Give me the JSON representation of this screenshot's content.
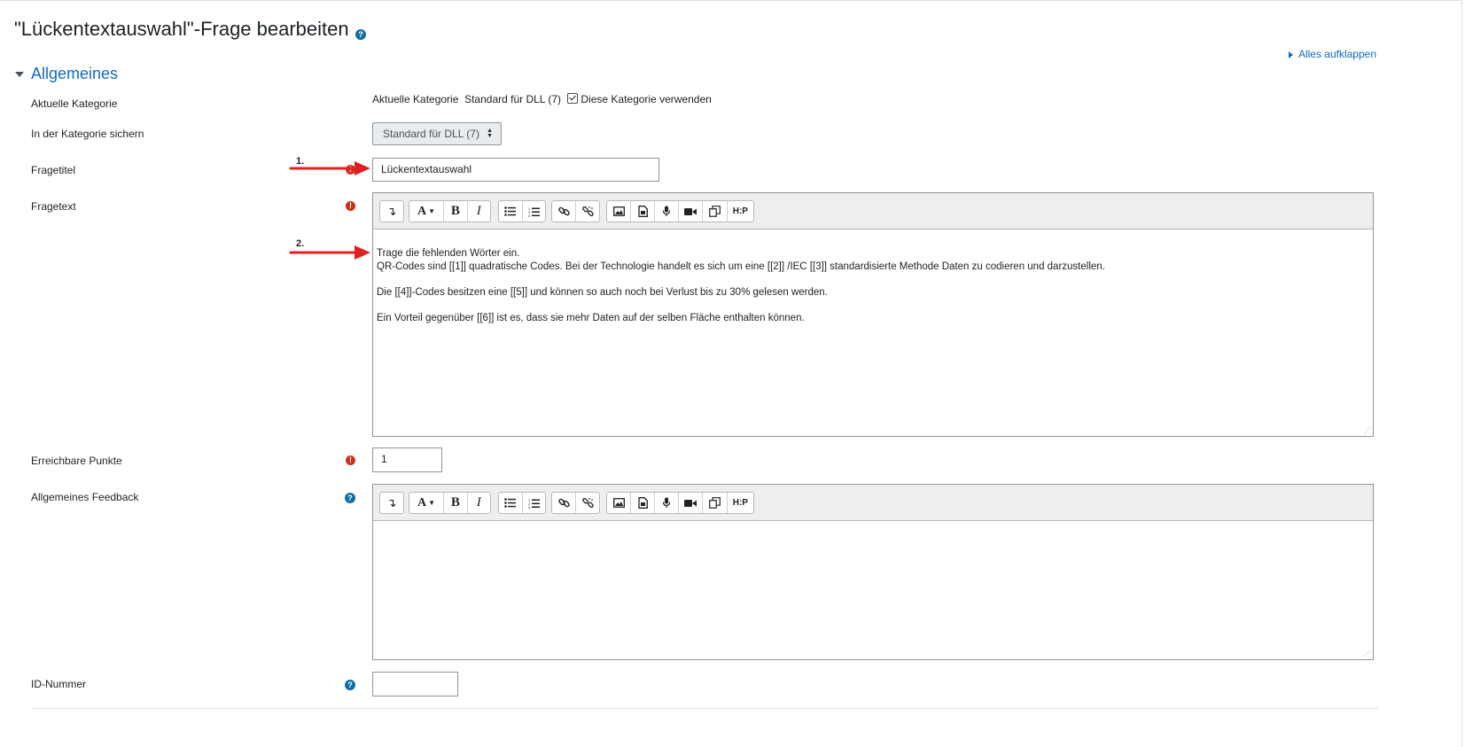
{
  "page": {
    "title": "\"Lückentextauswahl\"-Frage bearbeiten",
    "expand_all": "Alles aufklappen",
    "section": "Allgemeines"
  },
  "fields": {
    "current_category_label": "Aktuelle Kategorie",
    "current_category_prefix": "Aktuelle Kategorie",
    "current_category_value": "Standard für DLL (7)",
    "use_category_label": "Diese Kategorie verwenden",
    "save_in_category_label": "In der Kategorie sichern",
    "save_in_category_value": "Standard für DLL (7)",
    "question_title_label": "Fragetitel",
    "question_title_value": "Lückentextauswahl",
    "question_text_label": "Fragetext",
    "points_label": "Erreichbare Punkte",
    "points_value": "1",
    "general_feedback_label": "Allgemeines Feedback",
    "id_number_label": "ID-Nummer",
    "id_number_value": ""
  },
  "question_text": {
    "line1": "Trage die fehlenden Wörter ein.",
    "line2": "QR-Codes sind [[1]] quadratische Codes. Bei der Technologie handelt es sich um eine [[2]] /IEC [[3]] standardisierte Methode Daten zu codieren und darzustellen.",
    "para2": "Die [[4]]-Codes besitzen eine [[5]] und können so auch noch bei Verlust bis zu 30% gelesen werden.",
    "para3": "Ein Vorteil gegenüber [[6]] ist es, dass sie mehr Daten auf der selben Fläche enthalten können."
  },
  "annotations": {
    "arrow1": "1.",
    "arrow2": "2."
  },
  "toolbar": {
    "icons": [
      "collapse-icon",
      "font-icon",
      "bold-icon",
      "italic-icon",
      "bullet-list-icon",
      "numbered-list-icon",
      "link-icon",
      "unlink-icon",
      "image-icon",
      "media-icon",
      "microphone-icon",
      "video-icon",
      "copy-icon",
      "h5p-icon"
    ],
    "bold": "B",
    "italic": "I",
    "font": "A",
    "h5p": "H:P"
  },
  "colors": {
    "link": "#0f6cbf",
    "required": "#ca3120",
    "help": "#0f6fa5",
    "arrow": "#e02020"
  }
}
